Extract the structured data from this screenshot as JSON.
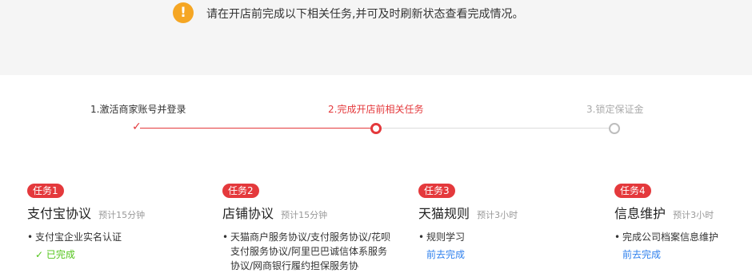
{
  "notice": {
    "icon": "exclamation-icon",
    "text": "请在开店前完成以下相关任务,并可及时刷新状态查看完成情况。"
  },
  "steps": [
    {
      "label": "1.激活商家账号并登录",
      "state": "done"
    },
    {
      "label": "2.完成开店前相关任务",
      "state": "current"
    },
    {
      "label": "3.锁定保证金",
      "state": "pending"
    }
  ],
  "tasks": [
    {
      "badge": "任务1",
      "title": "支付宝协议",
      "estimate": "预计15分钟",
      "item": "支付宝企业实名认证",
      "status": "已完成",
      "status_icon": "check-icon"
    },
    {
      "badge": "任务2",
      "title": "店铺协议",
      "estimate": "预计15分钟",
      "item": "天猫商户服务协议/支付服务协议/花呗支付服务协议/阿里巴巴诚信体系服务协议/网商银行履约担保服务协"
    },
    {
      "badge": "任务3",
      "title": "天猫规则",
      "estimate": "预计3小时",
      "item": "规则学习",
      "link": "前去完成"
    },
    {
      "badge": "任务4",
      "title": "信息维护",
      "estimate": "预计3小时",
      "item": "完成公司档案信息维护",
      "link": "前去完成"
    }
  ],
  "colors": {
    "accent": "#e4393c",
    "warning": "#f5a623",
    "success": "#52c41a",
    "link": "#2f80ed"
  }
}
